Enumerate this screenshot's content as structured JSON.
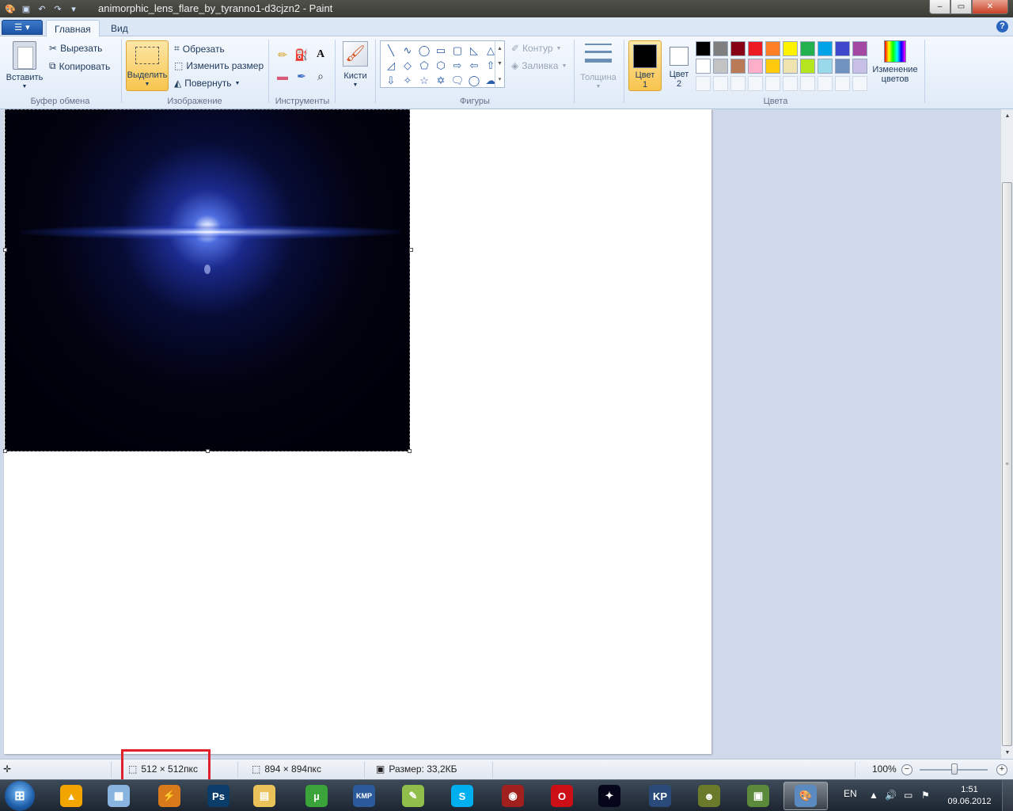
{
  "titlebar": {
    "title": "animorphic_lens_flare_by_tyranno1-d3cjzn2 - Paint",
    "minimize": "‒",
    "maximize": "▭",
    "close": "✕"
  },
  "tabs": {
    "app_menu_arrow": "▾",
    "home": "Главная",
    "view": "Вид",
    "help": "?"
  },
  "ribbon": {
    "clipboard": {
      "paste": "Вставить",
      "cut": "Вырезать",
      "copy": "Копировать",
      "group": "Буфер обмена"
    },
    "image": {
      "select": "Выделить",
      "crop": "Обрезать",
      "resize": "Изменить размер",
      "rotate": "Повернуть",
      "group": "Изображение"
    },
    "tools": {
      "group": "Инструменты",
      "text_tool": "A"
    },
    "brushes": "Кисти",
    "shapes": {
      "outline": "Контур",
      "fill": "Заливка",
      "group": "Фигуры",
      "items": [
        "╲",
        "∿",
        "◯",
        "▭",
        "▢",
        "◺",
        "△",
        "◿",
        "◇",
        "⬠",
        "⬡",
        "⇨",
        "⇦",
        "⇧",
        "⇩",
        "✧",
        "☆",
        "✡",
        "🗨",
        "◯",
        "☁"
      ]
    },
    "thickness": "Толщина",
    "color1": {
      "label": "Цвет 1",
      "line1": "Цвет",
      "line2": "1",
      "value": "#000000"
    },
    "color2": {
      "label": "Цвет 2",
      "line1": "Цвет",
      "line2": "2",
      "value": "#ffffff"
    },
    "colors_group": "Цвета",
    "edit_colors": {
      "line1": "Изменение",
      "line2": "цветов"
    },
    "palette": [
      "#000000",
      "#7f7f7f",
      "#880015",
      "#ed1c24",
      "#ff7f27",
      "#fff200",
      "#22b14c",
      "#00a2e8",
      "#3f48cc",
      "#a349a4",
      "#ffffff",
      "#c3c3c3",
      "#b97a57",
      "#ffaec9",
      "#ffc90e",
      "#efe4b0",
      "#b5e61d",
      "#99d9ea",
      "#7092be",
      "#c8bfe7",
      "",
      "",
      "",
      "",
      "",
      "",
      "",
      "",
      "",
      ""
    ]
  },
  "statusbar": {
    "selection_size": "512 × 512пкс",
    "image_size": "894 × 894пкс",
    "file_size": "Размер: 33,2КБ",
    "zoom": "100%",
    "zoom_out": "−",
    "zoom_in": "+",
    "zoom_level_percent": 100
  },
  "taskbar": {
    "start": "⊞",
    "apps": [
      {
        "name": "aimp",
        "glyph": "▲",
        "color": "#f2a400"
      },
      {
        "name": "calculator",
        "glyph": "▦",
        "color": "#8ab4e0"
      },
      {
        "name": "winamp",
        "glyph": "⚡",
        "color": "#d8791c"
      },
      {
        "name": "photoshop",
        "glyph": "Ps",
        "color": "#0b3d6b"
      },
      {
        "name": "explorer",
        "glyph": "▤",
        "color": "#e9c25a"
      },
      {
        "name": "utorrent",
        "glyph": "µ",
        "color": "#3aa43a"
      },
      {
        "name": "kmplayer",
        "glyph": "KMP",
        "color": "#2a5a9a"
      },
      {
        "name": "notepad",
        "glyph": "✎",
        "color": "#8fbf4a"
      },
      {
        "name": "skype",
        "glyph": "S",
        "color": "#00aff0"
      },
      {
        "name": "game",
        "glyph": "◉",
        "color": "#a02020"
      },
      {
        "name": "opera",
        "glyph": "O",
        "color": "#cc0f16"
      },
      {
        "name": "lens-flare-thumb",
        "glyph": "✦",
        "color": "#05061a"
      },
      {
        "name": "kp2",
        "glyph": "KP",
        "color": "#2a4a7a"
      },
      {
        "name": "robot",
        "glyph": "☻",
        "color": "#6a7a2a"
      },
      {
        "name": "minecraft",
        "glyph": "▣",
        "color": "#5a8a3a"
      },
      {
        "name": "paint",
        "glyph": "🎨",
        "color": "#5a8ac0"
      }
    ],
    "lang": "EN",
    "time": "1:51",
    "date": "09.06.2012"
  }
}
